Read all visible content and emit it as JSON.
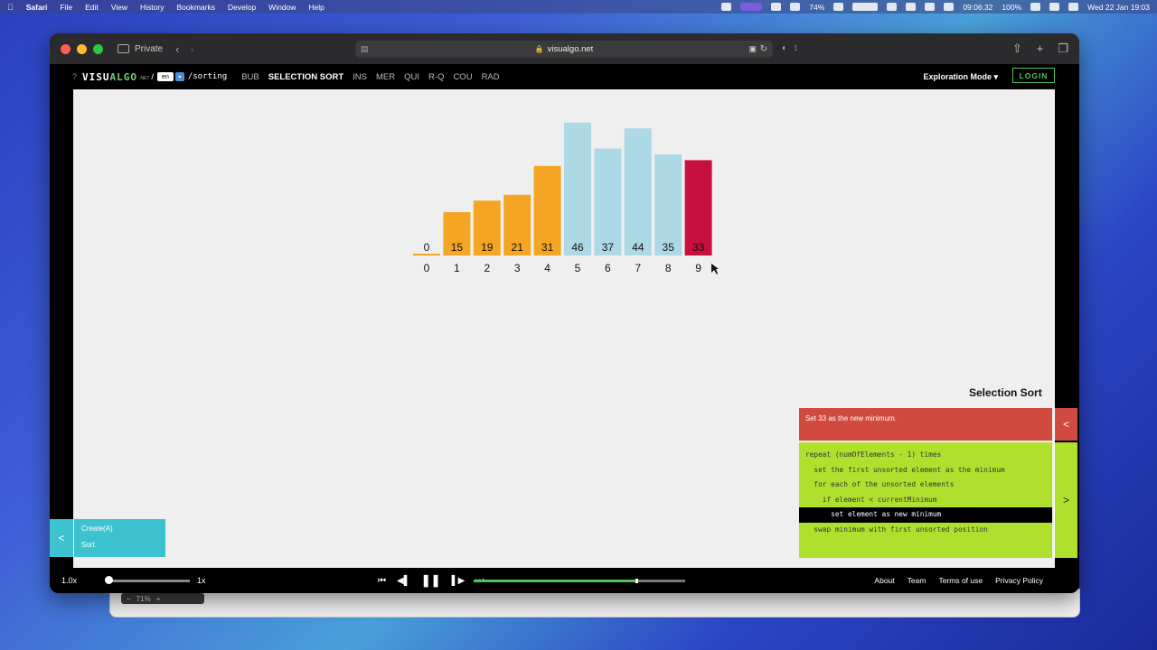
{
  "menubar": {
    "apple": "",
    "items": [
      "Safari",
      "File",
      "Edit",
      "View",
      "History",
      "Bookmarks",
      "Develop",
      "Window",
      "Help"
    ],
    "battery_pct_small": "74%",
    "time_small": "09:06:32",
    "battery_pct": "100%",
    "datetime": "Wed 22 Jan  19:03"
  },
  "browser": {
    "private_label": "Private",
    "url": "visualgo.net",
    "blocked_count": "1"
  },
  "navbar": {
    "logo_a": "VISU",
    "logo_b": "ALGO",
    "logo_net": ".NET",
    "slash": "/",
    "lang": "en",
    "slug": "/sorting",
    "algos": [
      "BUB",
      "SELECTION SORT",
      "INS",
      "MER",
      "QUI",
      "R-Q",
      "COU",
      "RAD"
    ],
    "active_algo_index": 1,
    "mode": "Exploration Mode ▾",
    "login": "LOGIN"
  },
  "colors": {
    "sorted": "#f4a524",
    "unsorted": "#add8e6",
    "current_min": "#c8103e",
    "status_red": "#d04a3f",
    "code_green": "#b0e02e",
    "action_teal": "#3cc3cf"
  },
  "array": {
    "values": [
      0,
      15,
      19,
      21,
      31,
      46,
      37,
      44,
      35,
      33
    ],
    "indices": [
      "0",
      "1",
      "2",
      "3",
      "4",
      "5",
      "6",
      "7",
      "8",
      "9"
    ],
    "states": [
      "sorted",
      "sorted",
      "sorted",
      "sorted",
      "sorted",
      "unsorted",
      "unsorted",
      "unsorted",
      "unsorted",
      "current_min"
    ]
  },
  "panel": {
    "algo_title": "Selection Sort",
    "status": "Set 33 as the new minimum.",
    "status_toggle": "<",
    "code_toggle": ">",
    "code": [
      "repeat (numOfElements - 1) times",
      "  set the first unsorted element as the minimum",
      "  for each of the unsorted elements",
      "    if element < currentMinimum",
      "      set element as new minimum",
      "  swap minimum with first unsorted position"
    ],
    "active_line": 4
  },
  "actions": {
    "toggle": "<",
    "items": [
      "Create(A)",
      "Sort"
    ]
  },
  "media": {
    "speed_left": "1.0x",
    "speed_right": "1x",
    "speed_fraction": 0.0,
    "progress_fraction": 0.77,
    "links": [
      "About",
      "Team",
      "Terms of use",
      "Privacy Policy"
    ]
  }
}
